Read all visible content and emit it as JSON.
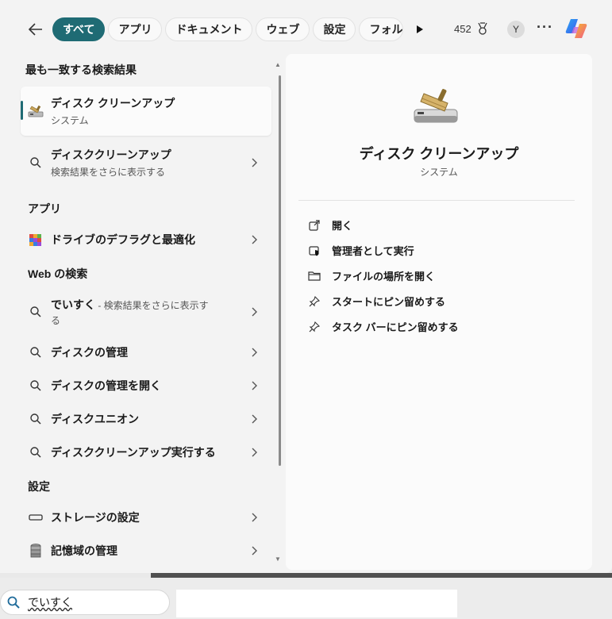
{
  "header": {
    "tabs": [
      {
        "label": "すべて",
        "active": true
      },
      {
        "label": "アプリ"
      },
      {
        "label": "ドキュメント"
      },
      {
        "label": "ウェブ"
      },
      {
        "label": "設定"
      },
      {
        "label": "フォル:"
      }
    ],
    "points": "452",
    "avatar_initial": "Y"
  },
  "left": {
    "best_match_title": "最も一致する検索結果",
    "best_match": {
      "name": "ディスク クリーンアップ",
      "type": "システム"
    },
    "suggestion": {
      "name": "ディスククリーンアップ",
      "sub": "検索結果をさらに表示する"
    },
    "apps_title": "アプリ",
    "apps": [
      {
        "name": "ドライブのデフラグと最適化"
      }
    ],
    "web_title": "Web の検索",
    "web": [
      {
        "name": "でいすく",
        "sub": " - 検索結果をさらに表示す",
        "sub2": "る"
      },
      {
        "name": "ディスクの管理"
      },
      {
        "name": "ディスクの管理を開く"
      },
      {
        "name": "ディスクユニオン"
      },
      {
        "name": "ディスククリーンアップ実行する"
      }
    ],
    "settings_title": "設定",
    "settings": [
      {
        "name": "ストレージの設定"
      },
      {
        "name": "記憶域の管理"
      }
    ]
  },
  "right": {
    "app_name": "ディスク クリーンアップ",
    "app_type": "システム",
    "actions": [
      {
        "label": "開く",
        "icon": "open-icon"
      },
      {
        "label": "管理者として実行",
        "icon": "shield-icon"
      },
      {
        "label": "ファイルの場所を開く",
        "icon": "folder-icon"
      },
      {
        "label": "スタートにピン留めする",
        "icon": "pin-icon"
      },
      {
        "label": "タスク バーにピン留めする",
        "icon": "pin-icon"
      }
    ]
  },
  "taskbar": {
    "search_value": "でいすく"
  },
  "colors": {
    "accent": "#1f6b74"
  }
}
